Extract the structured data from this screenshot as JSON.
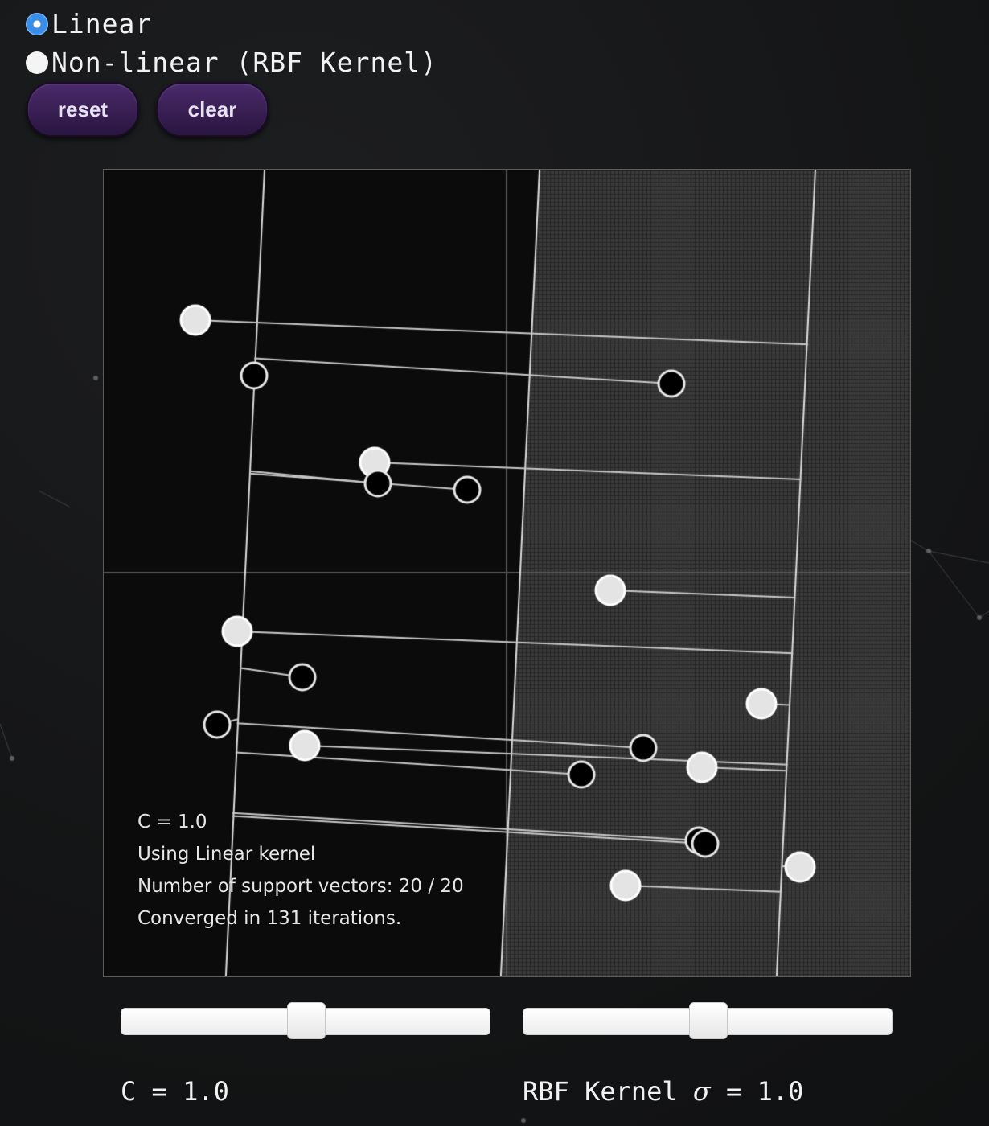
{
  "kernel_options": [
    {
      "label": "Linear",
      "checked": true
    },
    {
      "label": "Non-linear (RBF Kernel)",
      "checked": false
    }
  ],
  "buttons": {
    "reset": "reset",
    "clear": "clear"
  },
  "info": {
    "c_line": "C = 1.0",
    "kernel_line": "Using Linear kernel",
    "support_line": "Number of support vectors: 20 / 20",
    "iter_line": "Converged in 131 iterations."
  },
  "sliders": {
    "c_value": 0.5,
    "sigma_value": 0.5,
    "c_label": "C = 1.0",
    "sigma_label_prefix": "RBF Kernel ",
    "sigma_symbol": "σ",
    "sigma_label_suffix": " = 1.0"
  },
  "colors": {
    "accent_radio": "#3a8ee8",
    "button_bg": "#3a1f55",
    "positive_point": "#e4e4e4",
    "negative_point": "#000000"
  }
}
